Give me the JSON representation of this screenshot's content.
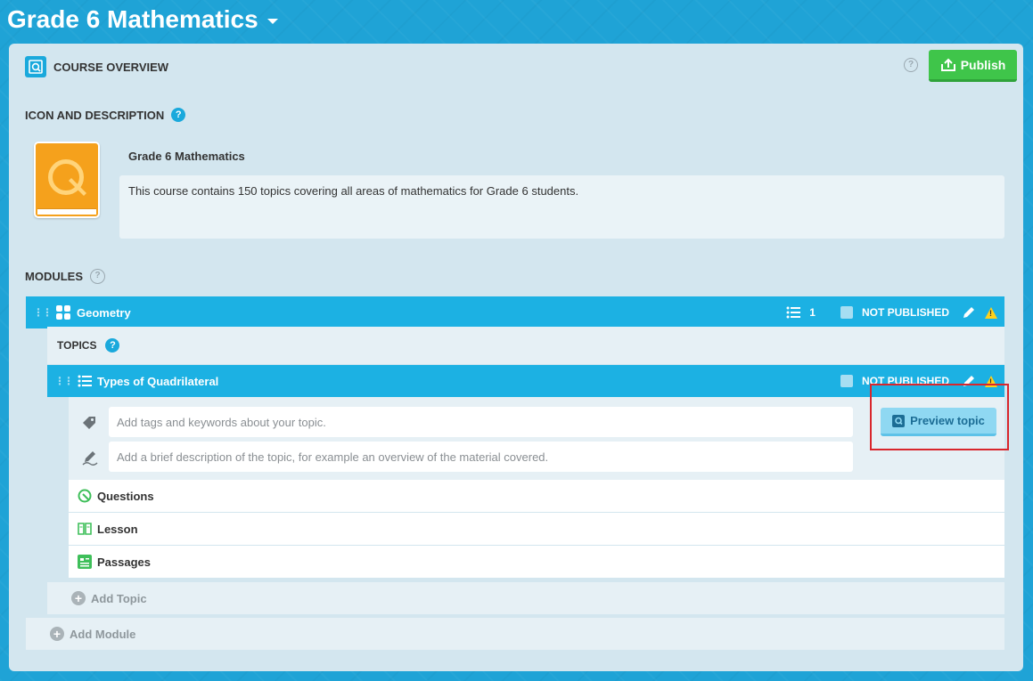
{
  "header": {
    "course_title": "Grade 6 Mathematics"
  },
  "overview": {
    "title": "COURSE OVERVIEW",
    "help_symbol": "?",
    "publish_label": "Publish"
  },
  "icon_section": {
    "label": "ICON AND DESCRIPTION",
    "help_symbol": "?",
    "course_name": "Grade 6 Mathematics",
    "description": "This course contains 150 topics covering all areas of mathematics for Grade 6 students."
  },
  "modules": {
    "label": "MODULES",
    "help_symbol": "?",
    "items": [
      {
        "name": "Geometry",
        "topic_count": "1",
        "status": "NOT PUBLISHED",
        "topics_label": "TOPICS",
        "topics_help_symbol": "?",
        "topics": [
          {
            "name": "Types of Quadrilateral",
            "status": "NOT PUBLISHED",
            "tags_placeholder": "Add tags and keywords about your topic.",
            "description_placeholder": "Add a brief description of the topic, for example an overview of the material covered.",
            "preview_label": "Preview topic",
            "contents": [
              "Questions",
              "Lesson",
              "Passages"
            ]
          }
        ],
        "add_topic_label": "Add Topic"
      }
    ],
    "add_module_label": "Add Module"
  },
  "colors": {
    "background": "#1fa3d6",
    "bar": "#1cb1e3",
    "publish": "#3fc54a",
    "highlight": "#d9262c"
  }
}
